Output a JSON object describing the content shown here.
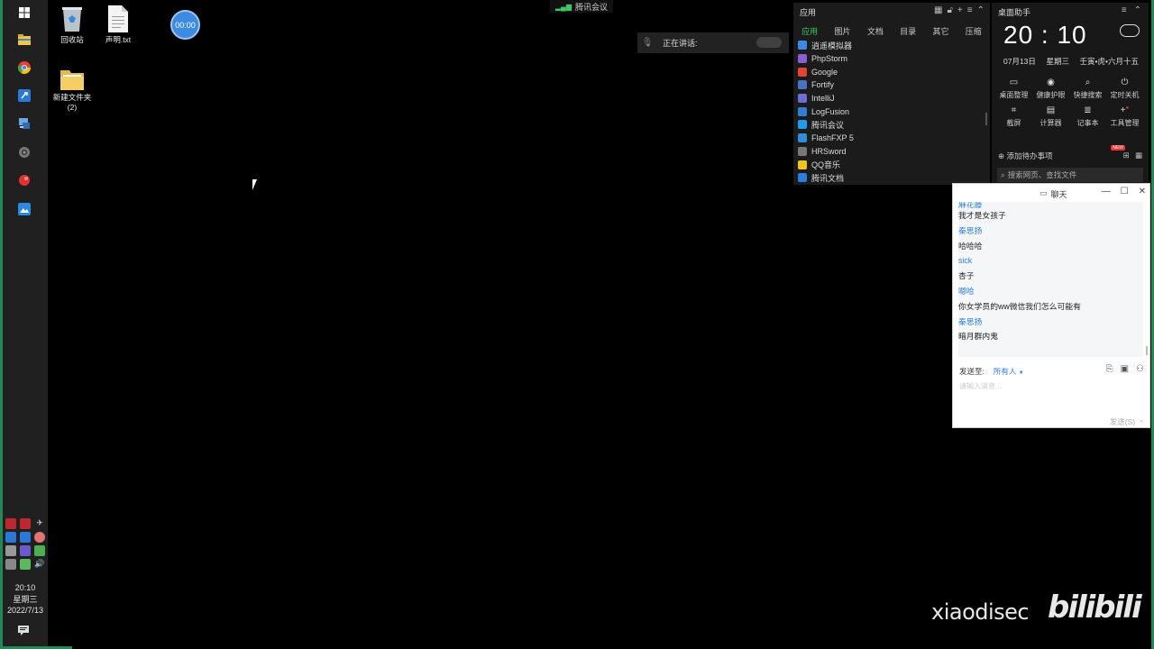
{
  "taskbar": {
    "clock_time": "20:10",
    "clock_day": "星期三",
    "clock_date": "2022/7/13"
  },
  "desktop": {
    "icons": [
      {
        "label": "回收站",
        "icon": "recycle-bin-icon"
      },
      {
        "label": "声明.txt",
        "icon": "text-file-icon"
      },
      {
        "label": "新建文件夹",
        "sub": "(2)",
        "icon": "folder-icon"
      }
    ],
    "timer": "00:00"
  },
  "meeting": {
    "indicator_label": "腾讯会议",
    "speaking_label": "正在讲话:"
  },
  "apps_panel": {
    "title": "应用",
    "tabs": [
      "应用",
      "图片",
      "文档",
      "目录",
      "其它",
      "压缩"
    ],
    "items": [
      {
        "label": "逍遥模拟器",
        "color": "#3b8be6"
      },
      {
        "label": "PhpStorm",
        "color": "#8a5cd6"
      },
      {
        "label": "Google",
        "color": "#e5452f"
      },
      {
        "label": "Fortify",
        "color": "#4a72c4"
      },
      {
        "label": "IntelliJ",
        "color": "#6d6dd8"
      },
      {
        "label": "LogFusion",
        "color": "#2f7fd9"
      },
      {
        "label": "腾讯会议",
        "color": "#1d9bf0"
      },
      {
        "label": "FlashFXP 5",
        "color": "#2e8fd6"
      },
      {
        "label": "HRSword",
        "color": "#777777"
      },
      {
        "label": "QQ音乐",
        "color": "#f0c419"
      },
      {
        "label": "腾讯文档",
        "color": "#2a7de1"
      }
    ]
  },
  "assistant": {
    "title": "桌面助手",
    "time": "20 : 10",
    "date": "07月13日",
    "weekday": "星期三",
    "lunar": "壬寅•虎•六月十五",
    "tools": [
      "桌面整理",
      "健康护眼",
      "快捷搜索",
      "定时关机",
      "截屏",
      "计算器",
      "记事本",
      "工具管理"
    ],
    "todo": "添加待办事项",
    "badge": "NEW",
    "search_placeholder": "搜索网页、查找文件"
  },
  "chat": {
    "title": "聊天",
    "partial_name": "麻花藤",
    "messages": [
      {
        "type": "text",
        "text": "我才是女孩子"
      },
      {
        "type": "name",
        "text": "秦思扬"
      },
      {
        "type": "text",
        "text": "哈哈哈"
      },
      {
        "type": "name",
        "text": "sick"
      },
      {
        "type": "text",
        "text": "杏子"
      },
      {
        "type": "name",
        "text": "嗯哈"
      },
      {
        "type": "text",
        "text": "你女学员的ww微信我们怎么可能有"
      },
      {
        "type": "name",
        "text": "秦思扬"
      },
      {
        "type": "text",
        "text": "暗月群内鬼"
      }
    ],
    "send_to_label": "发送至:",
    "send_to_value": "所有人",
    "input_placeholder": "请输入消息...",
    "send_label": "发送(S)"
  },
  "watermark": {
    "text": "xiaodisec",
    "logo": "bilibili"
  }
}
